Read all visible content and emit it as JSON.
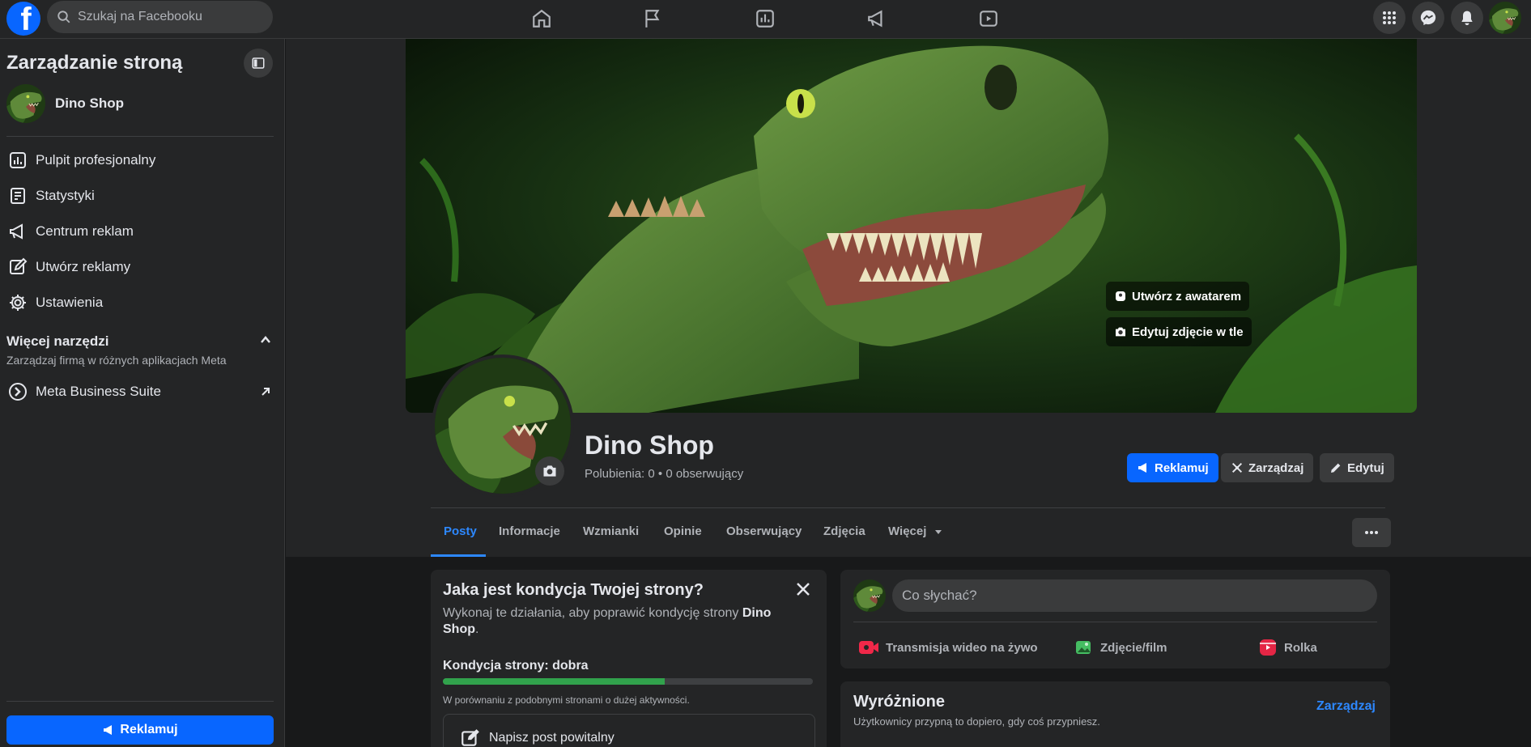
{
  "topbar": {
    "search_placeholder": "Szukaj na Facebooku",
    "logo_letter": "f",
    "nav_icons": [
      "home-icon",
      "flag-icon",
      "insights-icon",
      "megaphone-icon",
      "video-icon"
    ],
    "right_icons": [
      "menu-grid-icon",
      "messenger-icon",
      "bell-icon"
    ]
  },
  "sidebar": {
    "title": "Zarządzanie stroną",
    "page_name": "Dino Shop",
    "items": [
      {
        "label": "Pulpit profesjonalny",
        "icon": "dashboard-icon"
      },
      {
        "label": "Statystyki",
        "icon": "statistics-icon"
      },
      {
        "label": "Centrum reklam",
        "icon": "megaphone-icon"
      },
      {
        "label": "Utwórz reklamy",
        "icon": "pencil-square-icon"
      },
      {
        "label": "Ustawienia",
        "icon": "gear-icon"
      }
    ],
    "more_tools_title": "Więcej narzędzi",
    "more_tools_subtitle": "Zarządzaj firmą w różnych aplikacjach Meta",
    "meta_business": "Meta Business Suite",
    "promote_label": "Reklamuj"
  },
  "cover": {
    "avatar_button": "Utwórz z awatarem",
    "edit_cover_button": "Edytuj zdjęcie w tle"
  },
  "page": {
    "name": "Dino Shop",
    "stats": "Polubienia: 0 • 0 obserwujący",
    "buttons": {
      "promote": "Reklamuj",
      "manage": "Zarządzaj",
      "edit": "Edytuj"
    }
  },
  "tabs": [
    "Posty",
    "Informacje",
    "Wzmianki",
    "Opinie",
    "Obserwujący",
    "Zdjęcia",
    "Więcej"
  ],
  "health": {
    "title": "Jaka jest kondycja Twojej strony?",
    "desc_prefix": "Wykonaj te działania, aby poprawić kondycję strony ",
    "desc_page": "Dino Shop",
    "desc_suffix": ".",
    "condition": "Kondycja strony: dobra",
    "progress": 0.6,
    "comparison": "W porównaniu z podobnymi stronami o dużej aktywności.",
    "task": "Napisz post powitalny"
  },
  "composer": {
    "placeholder": "Co słychać?",
    "actions": [
      {
        "label": "Transmisja wideo na żywo",
        "color": "#f02849"
      },
      {
        "label": "Zdjęcie/film",
        "color": "#45bd62"
      },
      {
        "label": "Rolka",
        "color": "#e42645"
      }
    ]
  },
  "featured": {
    "title": "Wyróżnione",
    "subtitle": "Użytkownicy przypną to dopiero, gdy coś przypniesz.",
    "manage": "Zarządzaj"
  },
  "colors": {
    "accent": "#0866ff",
    "link": "#2d88ff",
    "progress": "#31a24c"
  }
}
